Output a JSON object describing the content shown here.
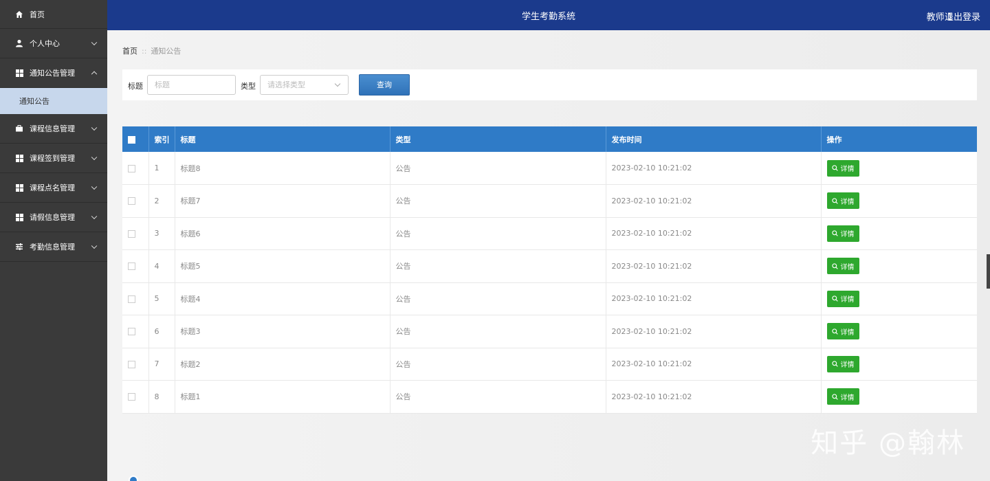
{
  "header": {
    "title": "学生考勤系统",
    "user": "教师 1",
    "logout": "退出登录"
  },
  "sidebar": {
    "items": [
      {
        "label": "首页",
        "icon": "home-icon"
      },
      {
        "label": "个人中心",
        "icon": "user-icon"
      },
      {
        "label": "通知公告管理",
        "icon": "grid-icon",
        "expanded": true,
        "sub": "通知公告"
      },
      {
        "label": "课程信息管理",
        "icon": "briefcase-icon"
      },
      {
        "label": "课程签到管理",
        "icon": "grid-icon"
      },
      {
        "label": "课程点名管理",
        "icon": "grid-icon"
      },
      {
        "label": "请假信息管理",
        "icon": "grid-icon"
      },
      {
        "label": "考勤信息管理",
        "icon": "sliders-icon"
      }
    ]
  },
  "breadcrumb": {
    "home": "首页",
    "sep": "::",
    "current": "通知公告"
  },
  "search": {
    "title_label": "标题",
    "title_placeholder": "标题",
    "type_label": "类型",
    "type_placeholder": "请选择类型",
    "query_button": "查询"
  },
  "table": {
    "columns": [
      "索引",
      "标题",
      "类型",
      "发布时间",
      "操作"
    ],
    "rows": [
      {
        "index": "1",
        "title": "标题8",
        "type": "公告",
        "time": "2023-02-10 10:21:02"
      },
      {
        "index": "2",
        "title": "标题7",
        "type": "公告",
        "time": "2023-02-10 10:21:02"
      },
      {
        "index": "3",
        "title": "标题6",
        "type": "公告",
        "time": "2023-02-10 10:21:02"
      },
      {
        "index": "4",
        "title": "标题5",
        "type": "公告",
        "time": "2023-02-10 10:21:02"
      },
      {
        "index": "5",
        "title": "标题4",
        "type": "公告",
        "time": "2023-02-10 10:21:02"
      },
      {
        "index": "6",
        "title": "标题3",
        "type": "公告",
        "time": "2023-02-10 10:21:02"
      },
      {
        "index": "7",
        "title": "标题2",
        "type": "公告",
        "time": "2023-02-10 10:21:02"
      },
      {
        "index": "8",
        "title": "标题1",
        "type": "公告",
        "time": "2023-02-10 10:21:02"
      }
    ],
    "detail_label": "详情"
  },
  "watermark": "知乎 @翰林",
  "colors": {
    "header": "#1b3a8c",
    "sidebar": "#3a3a3a",
    "table_header": "#2f7bc7",
    "detail_button": "#2ea82e",
    "submenu": "#c7d7ec"
  }
}
